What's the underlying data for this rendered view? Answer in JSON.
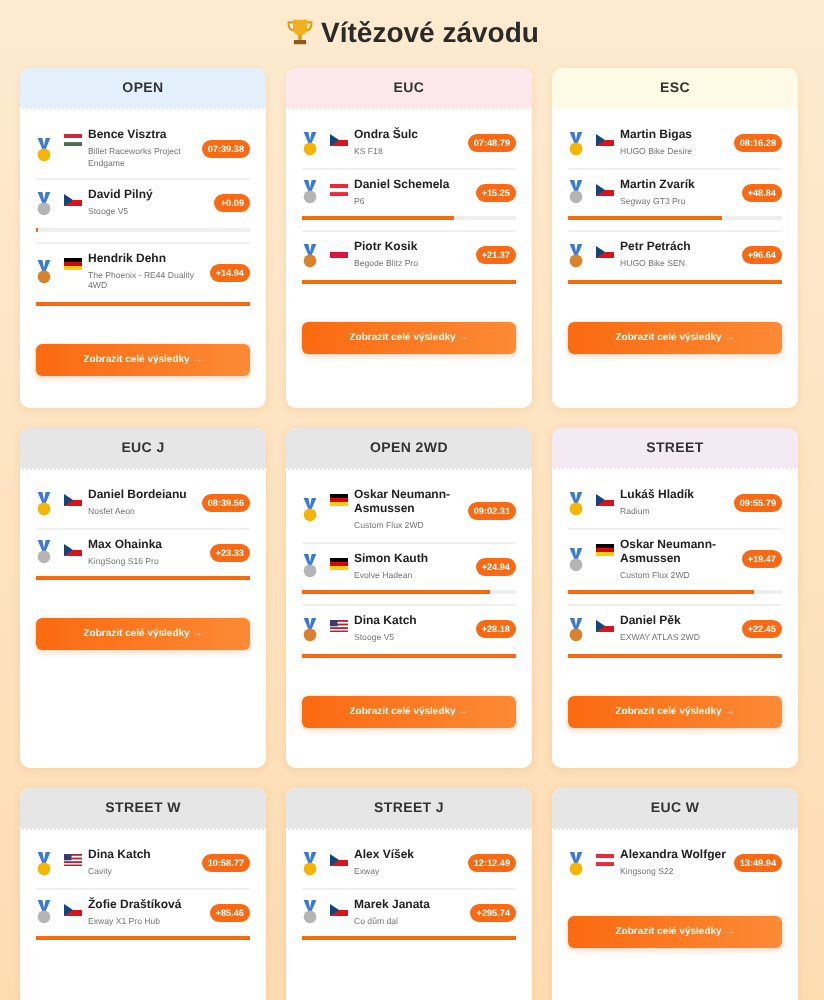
{
  "title": "Vítězové závodu",
  "categories": [
    {
      "name": "OPEN",
      "color": "#e3effa",
      "results": [
        {
          "flag": {
            "kind": "hu"
          },
          "name": "Bence Visztra",
          "vehicle": "Billet Raceworks Project Endgame",
          "time": "07:39.38"
        },
        {
          "flag": {
            "kind": "cz"
          },
          "name": "David Pilný",
          "vehicle": "Stooge V5",
          "time": "+0.09",
          "level": 0.01
        },
        {
          "flag": {
            "kind": "de"
          },
          "name": "Hendrik Dehn",
          "vehicle": "The Phoenix - RE44 Duality 4WD",
          "time": "+14.94",
          "level": 1
        }
      ],
      "button": "Zobrazit celé výsledky →"
    },
    {
      "name": "EUC",
      "color": "#fde9ed",
      "results": [
        {
          "flag": {
            "kind": "cz"
          },
          "name": "Ondra Šulc",
          "vehicle": "KS F18",
          "time": "07:48.79"
        },
        {
          "flag": {
            "kind": "at"
          },
          "name": "Daniel Schemela",
          "vehicle": "P6",
          "time": "+15.25",
          "level": 0.71
        },
        {
          "flag": {
            "kind": "pl"
          },
          "name": "Piotr Kosik",
          "vehicle": "Begode Blitz Pro",
          "time": "+21.37",
          "level": 1
        }
      ],
      "button": "Zobrazit celé výsledky →"
    },
    {
      "name": "ESC",
      "color": "#fdfbe5",
      "results": [
        {
          "flag": {
            "kind": "cz"
          },
          "name": "Martin Bigas",
          "vehicle": "HUGO Bike Desire",
          "time": "08:16.28"
        },
        {
          "flag": {
            "kind": "cz"
          },
          "name": "Martin Zvarík",
          "vehicle": "Segway GT3 Pro",
          "time": "+48.84",
          "level": 0.72
        },
        {
          "flag": {
            "kind": "cz"
          },
          "name": "Petr Petrách",
          "vehicle": "HUGO Bike SEN",
          "time": "+96.64",
          "level": 1
        }
      ],
      "button": "Zobrazit celé výsledky →"
    },
    {
      "name": "EUC J",
      "color": "#e6e6e6",
      "results": [
        {
          "flag": {
            "kind": "cz"
          },
          "name": "Daniel Bordeianu",
          "vehicle": "Nosfet Aeon",
          "time": "08:39.56"
        },
        {
          "flag": {
            "kind": "cz"
          },
          "name": "Max Ohainka",
          "vehicle": "KingSong S16 Pro",
          "time": "+23.33",
          "level": 1
        }
      ],
      "button": "Zobrazit celé výsledky →"
    },
    {
      "name": "OPEN 2WD",
      "color": "#e6e6e6",
      "results": [
        {
          "flag": {
            "kind": "de"
          },
          "name": "Oskar Neumann-Asmussen",
          "vehicle": "Custom Flux 2WD",
          "time": "09:02.31"
        },
        {
          "flag": {
            "kind": "de"
          },
          "name": "Simon Kauth",
          "vehicle": "Evolve Hadean",
          "time": "+24.94",
          "level": 0.88
        },
        {
          "flag": {
            "kind": "us"
          },
          "name": "Dina Katch",
          "vehicle": "Stooge V5",
          "time": "+28.18",
          "level": 1
        }
      ],
      "button": "Zobrazit celé výsledky →"
    },
    {
      "name": "STREET",
      "color": "#f4eaf4",
      "results": [
        {
          "flag": {
            "kind": "cz"
          },
          "name": "Lukáš Hladík",
          "vehicle": "Radium",
          "time": "09:55.79"
        },
        {
          "flag": {
            "kind": "de"
          },
          "name": "Oskar Neumann-Asmussen",
          "vehicle": "Custom Flux 2WD",
          "time": "+19.47",
          "level": 0.87
        },
        {
          "flag": {
            "kind": "cz"
          },
          "name": "Daniel Pěk",
          "vehicle": "EXWAY ATLAS 2WD",
          "time": "+22.45",
          "level": 1
        }
      ],
      "button": "Zobrazit celé výsledky →"
    },
    {
      "name": "STREET W",
      "color": "#e6e6e6",
      "results": [
        {
          "flag": {
            "kind": "us"
          },
          "name": "Dina Katch",
          "vehicle": "Cavity",
          "time": "10:58.77"
        },
        {
          "flag": {
            "kind": "cz"
          },
          "name": "Žofie Draštíková",
          "vehicle": "Exway X1 Pro Hub",
          "time": "+85.46",
          "level": 1
        }
      ]
    },
    {
      "name": "STREET J",
      "color": "#e6e6e6",
      "results": [
        {
          "flag": {
            "kind": "cz"
          },
          "name": "Alex Víšek",
          "vehicle": "Exway",
          "time": "12:12.49"
        },
        {
          "flag": {
            "kind": "cz"
          },
          "name": "Marek Janata",
          "vehicle": "Co dům dal",
          "time": "+295.74",
          "level": 1
        }
      ]
    },
    {
      "name": "EUC W",
      "color": "#e6e6e6",
      "results": [
        {
          "flag": {
            "kind": "at"
          },
          "name": "Alexandra Wolfger",
          "vehicle": "Kingsong S22",
          "time": "13:49.94"
        }
      ],
      "button": "Zobrazit celé výsledky →"
    }
  ]
}
